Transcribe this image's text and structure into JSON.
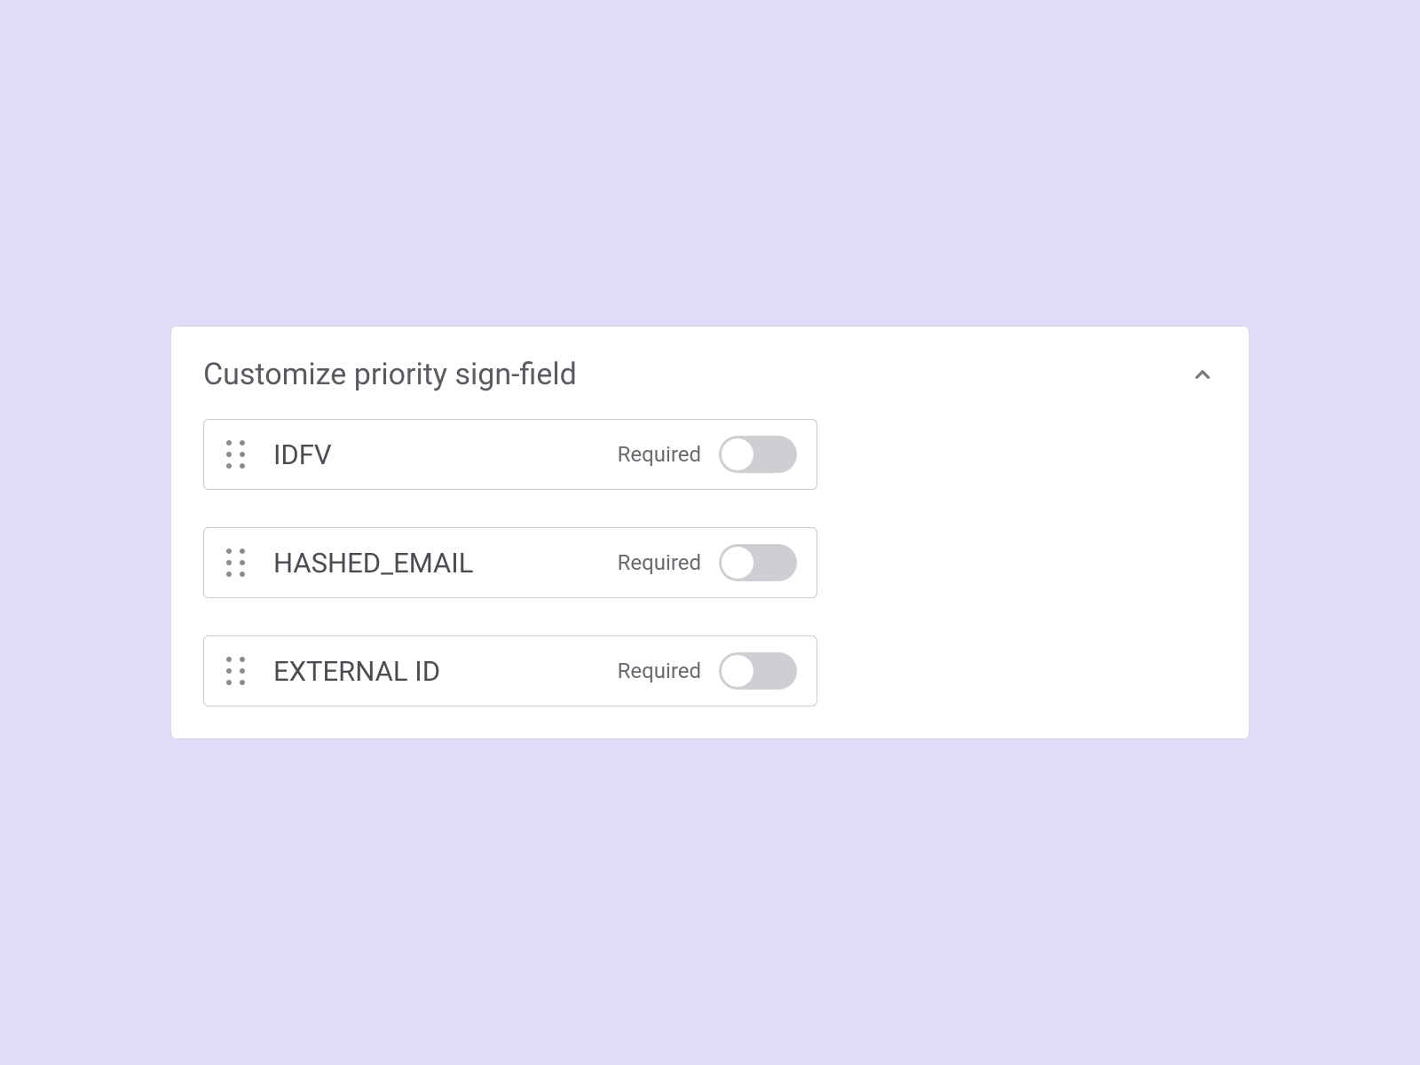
{
  "panel": {
    "title": "Customize priority sign-field",
    "required_label": "Required",
    "fields": [
      {
        "label": "IDFV",
        "required": false
      },
      {
        "label": "HASHED_EMAIL",
        "required": false
      },
      {
        "label": "EXTERNAL ID",
        "required": false
      }
    ]
  }
}
